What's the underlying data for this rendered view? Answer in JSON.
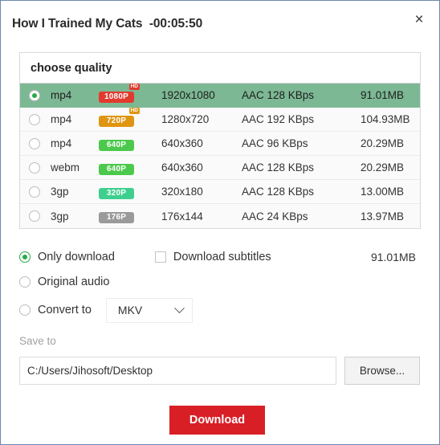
{
  "window": {
    "title": "How I Trained My Cats  -00:05:50",
    "close_icon": "close-icon",
    "close_glyph": "×",
    "border_color": "#6b87ad"
  },
  "quality_table": {
    "header": "choose quality",
    "selected_index": 0,
    "selected_row_color": "#7cb894",
    "rows": [
      {
        "format": "mp4",
        "badge": "1080P",
        "badge_color": "#e23a2e",
        "hd": "HD",
        "resolution": "1920x1080",
        "audio": "AAC 128 KBps",
        "size": "91.01MB",
        "selected": true
      },
      {
        "format": "mp4",
        "badge": "720P",
        "badge_color": "#e09512",
        "hd": "HD",
        "resolution": "1280x720",
        "audio": "AAC 192 KBps",
        "size": "104.93MB",
        "selected": false
      },
      {
        "format": "mp4",
        "badge": "640P",
        "badge_color": "#4cc94c",
        "hd": "",
        "resolution": "640x360",
        "audio": "AAC 96 KBps",
        "size": "20.29MB",
        "selected": false
      },
      {
        "format": "webm",
        "badge": "640P",
        "badge_color": "#4cc94c",
        "hd": "",
        "resolution": "640x360",
        "audio": "AAC 128 KBps",
        "size": "20.29MB",
        "selected": false
      },
      {
        "format": "3gp",
        "badge": "320P",
        "badge_color": "#3ecf8e",
        "hd": "",
        "resolution": "320x180",
        "audio": "AAC 128 KBps",
        "size": "13.00MB",
        "selected": false
      },
      {
        "format": "3gp",
        "badge": "176P",
        "badge_color": "#9a9a9a",
        "hd": "",
        "resolution": "176x144",
        "audio": "AAC 24 KBps",
        "size": "13.97MB",
        "selected": false
      }
    ]
  },
  "options": {
    "only_download": "Only download",
    "download_subtitles": "Download subtitles",
    "original_audio": "Original audio",
    "convert_to": "Convert to",
    "selected_mode": "only_download",
    "subtitles_checked": false,
    "format_value": "MKV",
    "format_options": [
      "MKV"
    ],
    "total_size": "91.01MB",
    "accent_color": "#2aa84a"
  },
  "save": {
    "label": "Save to",
    "path": "C:/Users/Jihosoft/Desktop",
    "browse_label": "Browse..."
  },
  "action": {
    "download_label": "Download",
    "download_color": "#d81f26"
  }
}
